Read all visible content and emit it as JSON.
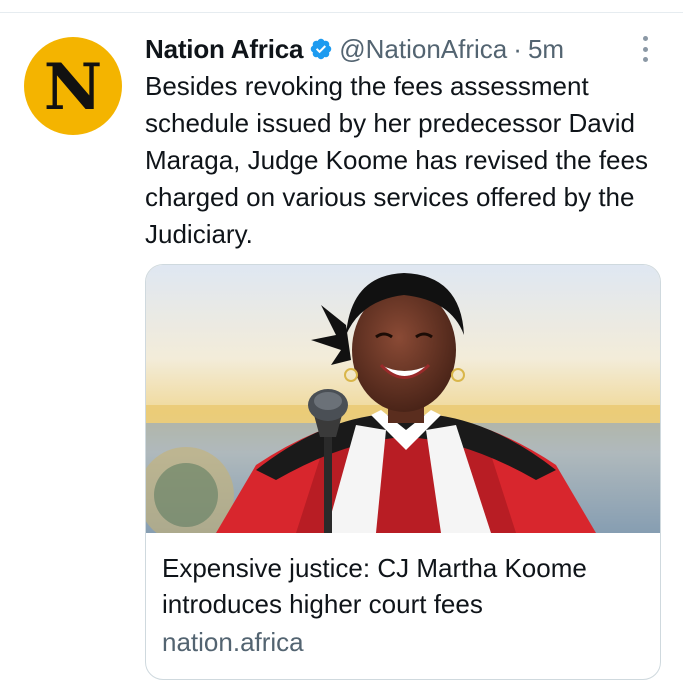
{
  "tweet": {
    "avatar_letter": "N",
    "author_name": "Nation Africa",
    "verified_icon": "verified-badge-icon",
    "handle": "@NationAfrica",
    "separator": "·",
    "timestamp": "5m",
    "more_icon": "more-options-icon",
    "text": "Besides revoking the fees assessment schedule issued by her predecessor David Maraga, Judge Koome has revised the fees charged on various services offered by the Judiciary."
  },
  "card": {
    "image_alt": "Judge Martha Koome speaking at a microphone in red and white judicial robes",
    "title": "Expensive justice: CJ Martha Koome introduces higher court fees",
    "domain": "nation.africa"
  },
  "colors": {
    "avatar_bg": "#f4b400",
    "verified": "#1d9bf0",
    "secondary_text": "#536471",
    "robe_red": "#d8262d"
  }
}
